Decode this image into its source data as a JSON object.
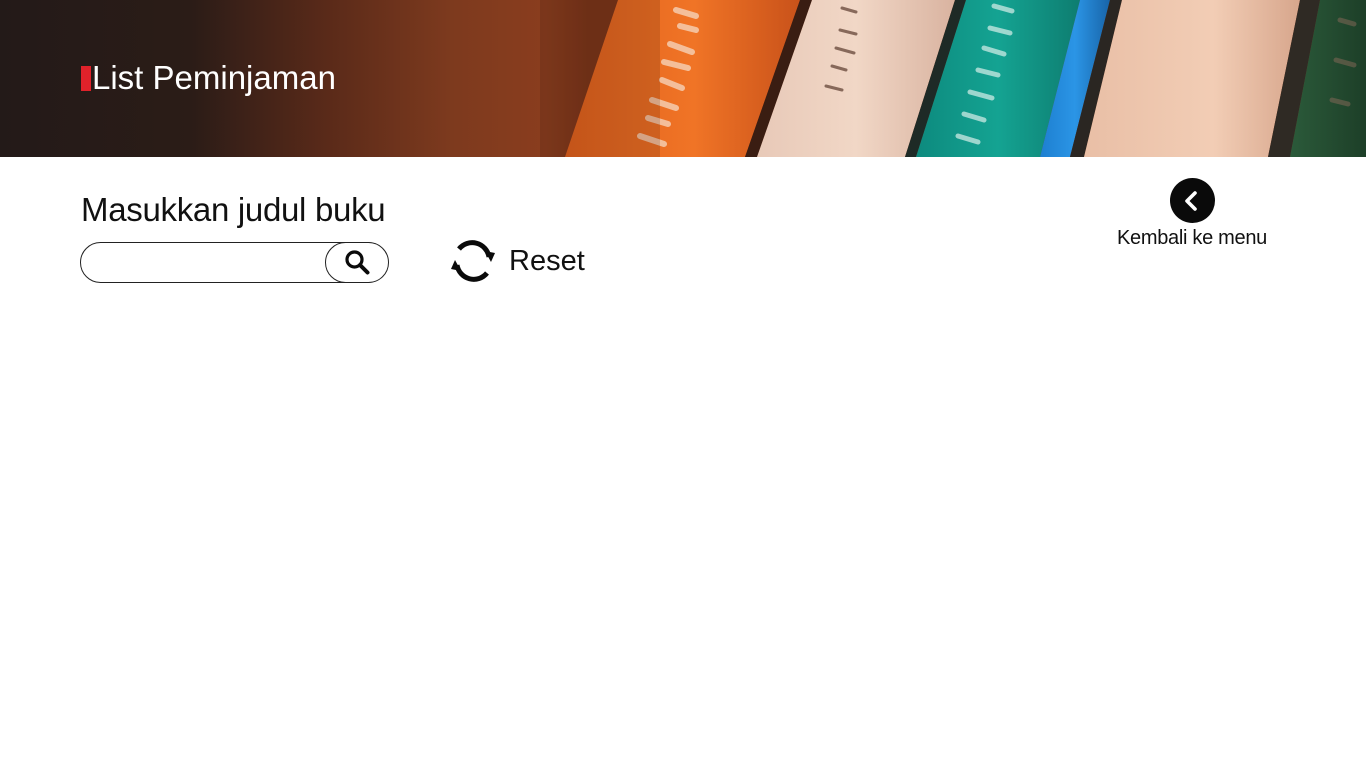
{
  "header": {
    "title": "List Peminjaman",
    "accent_color": "#e0222a"
  },
  "search": {
    "label": "Masukkan judul buku",
    "value": "",
    "placeholder": "",
    "button_icon": "search-icon"
  },
  "reset": {
    "label": "Reset",
    "icon": "refresh-icon"
  },
  "back": {
    "label": "Kembali ke menu",
    "icon": "chevron-left-icon"
  }
}
